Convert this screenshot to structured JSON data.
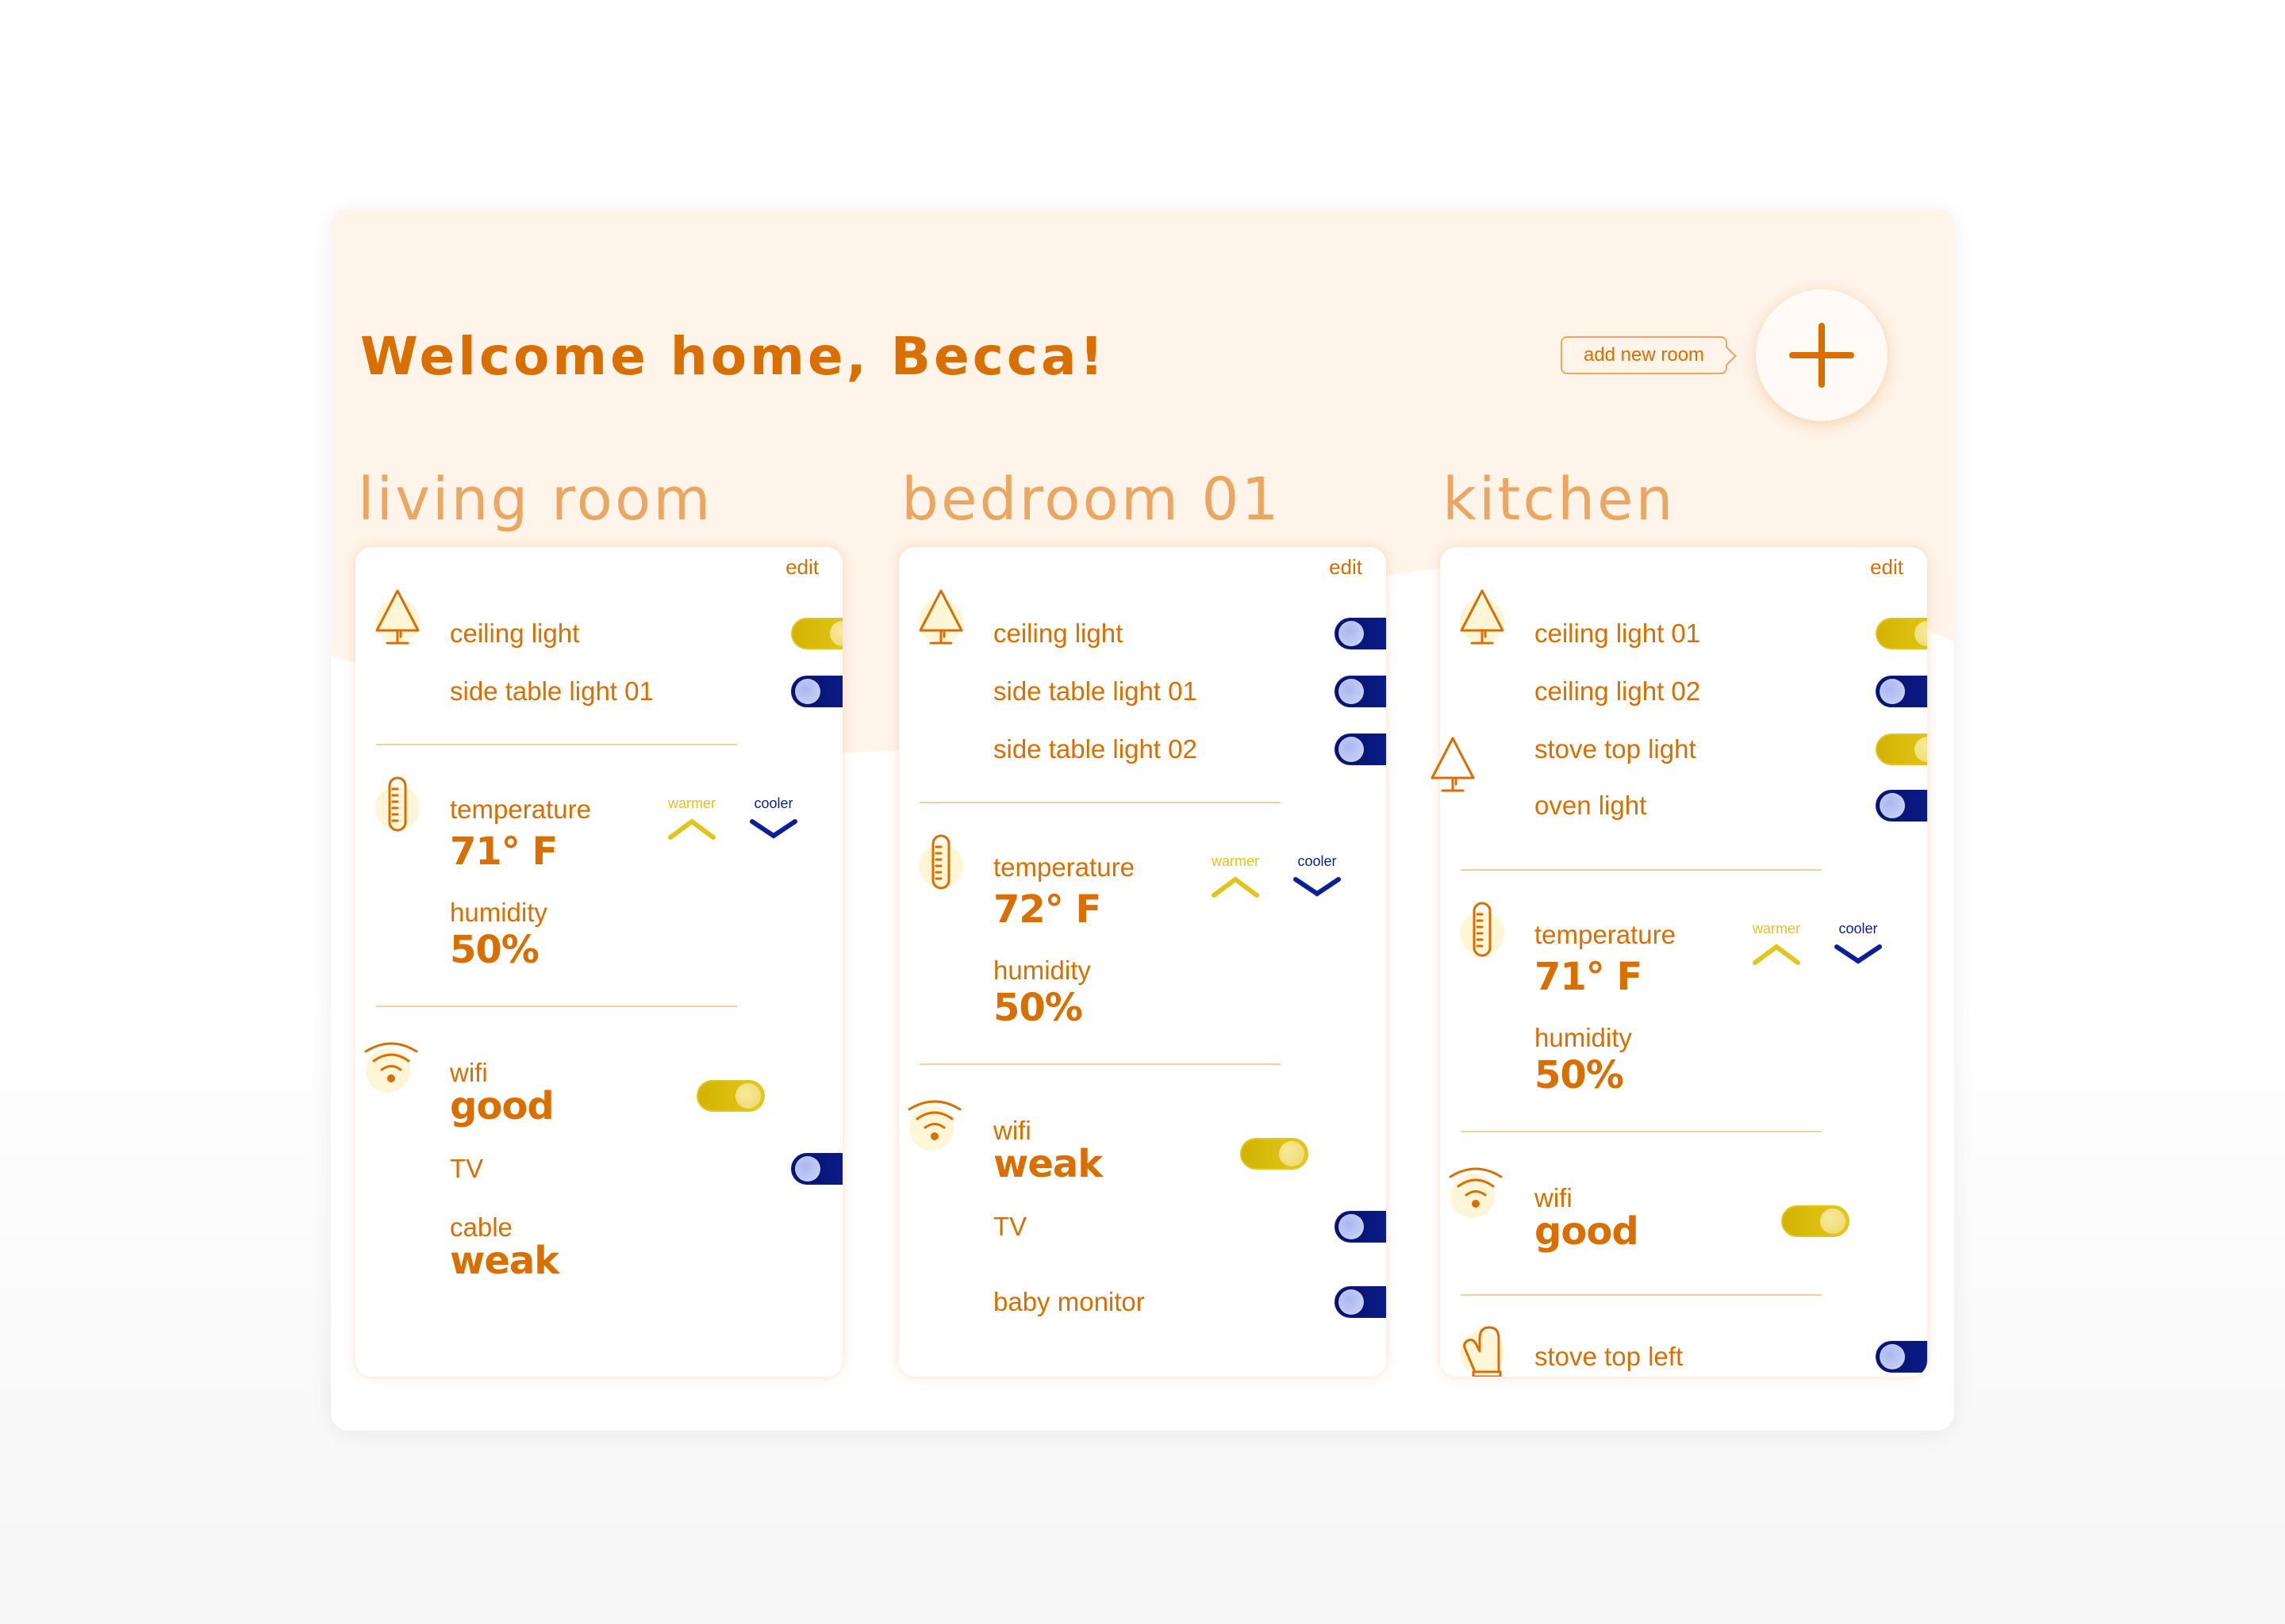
{
  "header": {
    "title": "Welcome home, Becca!",
    "add_room_label": "add new room",
    "add_icon": "plus-icon"
  },
  "colors": {
    "accent": "#d96f00",
    "room_title": "#eba662",
    "on": "#e2c51a",
    "off": "#0c1f96",
    "bg": "#fef4ea"
  },
  "rooms": [
    {
      "name": "living room",
      "edit": "edit",
      "lights": [
        {
          "label": "ceiling light",
          "on": true
        },
        {
          "label": "side table light 01",
          "on": false
        }
      ],
      "climate": {
        "temp_label": "temperature",
        "temp_value": "71° F",
        "humidity_label": "humidity",
        "humidity_value": "50%",
        "warmer": "warmer",
        "cooler": "cooler"
      },
      "wifi": {
        "label": "wifi",
        "value": "good",
        "on": true
      },
      "devices": [
        {
          "label": "TV",
          "on": false
        }
      ],
      "cable": {
        "label": "cable",
        "value": "weak"
      }
    },
    {
      "name": "bedroom 01",
      "edit": "edit",
      "lights": [
        {
          "label": "ceiling light",
          "on": false
        },
        {
          "label": "side table light 01",
          "on": false
        },
        {
          "label": "side table light 02",
          "on": false
        }
      ],
      "climate": {
        "temp_label": "temperature",
        "temp_value": "72° F",
        "humidity_label": "humidity",
        "humidity_value": "50%",
        "warmer": "warmer",
        "cooler": "cooler"
      },
      "wifi": {
        "label": "wifi",
        "value": "weak",
        "on": true
      },
      "devices": [
        {
          "label": "TV",
          "on": false
        },
        {
          "label": "baby monitor",
          "on": false
        }
      ]
    },
    {
      "name": "kitchen",
      "edit": "edit",
      "lights": [
        {
          "label": "ceiling light 01",
          "on": true
        },
        {
          "label": "ceiling light 02",
          "on": false
        },
        {
          "label": "stove top light",
          "on": true
        },
        {
          "label": "oven light",
          "on": false
        }
      ],
      "climate": {
        "temp_label": "temperature",
        "temp_value": "71° F",
        "humidity_label": "humidity",
        "humidity_value": "50%",
        "warmer": "warmer",
        "cooler": "cooler"
      },
      "wifi": {
        "label": "wifi",
        "value": "good",
        "on": true
      },
      "appliances": [
        {
          "label": "stove top left",
          "on": false
        }
      ]
    }
  ]
}
